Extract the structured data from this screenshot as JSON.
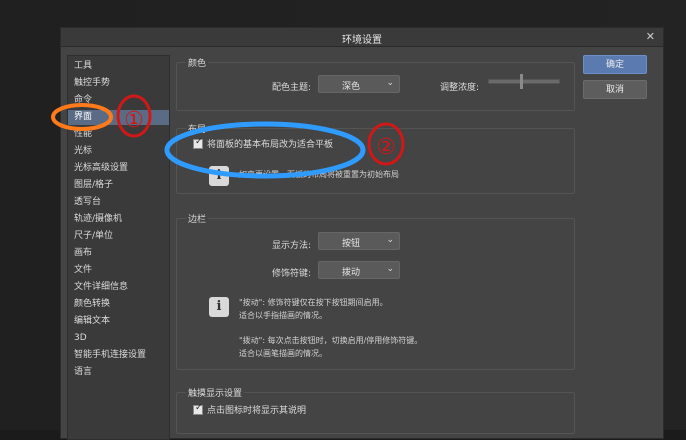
{
  "dialog": {
    "title": "环境设置",
    "close_symbol": "✕"
  },
  "sidebar": {
    "items": [
      {
        "label": "工具"
      },
      {
        "label": "触控手势"
      },
      {
        "label": "命令"
      },
      {
        "label": "界面"
      },
      {
        "label": "性能"
      },
      {
        "label": "光标"
      },
      {
        "label": "光标高级设置"
      },
      {
        "label": "图层/格子"
      },
      {
        "label": "透写台"
      },
      {
        "label": "轨迹/摄像机"
      },
      {
        "label": "尺子/单位"
      },
      {
        "label": "画布"
      },
      {
        "label": "文件"
      },
      {
        "label": "文件详细信息"
      },
      {
        "label": "颜色转换"
      },
      {
        "label": "编辑文本"
      },
      {
        "label": "3D"
      },
      {
        "label": "智能手机连接设置"
      },
      {
        "label": "语言"
      }
    ],
    "selected": "界面"
  },
  "color_group": {
    "title": "颜色",
    "theme_label": "配色主题:",
    "theme_value": "深色",
    "density_label": "调整浓度:",
    "density_level_fraction": 0.45
  },
  "layout_group": {
    "title": "布局",
    "tablet_checkbox_label": "将面板的基本布局改为适合平板",
    "tablet_checked": true,
    "note": "如变更设置，面板的布局将被重置为初始布局"
  },
  "edge_group": {
    "title": "边栏",
    "display_label": "显示方法:",
    "display_value": "按钮",
    "modifier_label": "修饰符键:",
    "modifier_value": "拨动",
    "info_line1": "\"按动\": 修饰符键仅在按下按钮期间启用。",
    "info_line2": "适合以手指描画的情况。",
    "info_line3": "\"拨动\": 每次点击按钮时，切换启用/停用修饰符键。",
    "info_line4": "适合以画笔描画的情况。"
  },
  "touch_group": {
    "title": "触摸显示设置",
    "tooltip_checkbox_label": "点击图标时将显示其说明",
    "tooltip_checked": true
  },
  "buttons": {
    "ok": "确定",
    "cancel": "取消"
  },
  "annotations": {
    "circle1_text": "①",
    "circle2_text": "②"
  },
  "colors": {
    "accent": "#5a7ab0",
    "selection": "#5a6b86",
    "annotation_red": "#d01818",
    "annotation_orange": "#ff7a1a",
    "annotation_blue": "#2f9bff"
  }
}
